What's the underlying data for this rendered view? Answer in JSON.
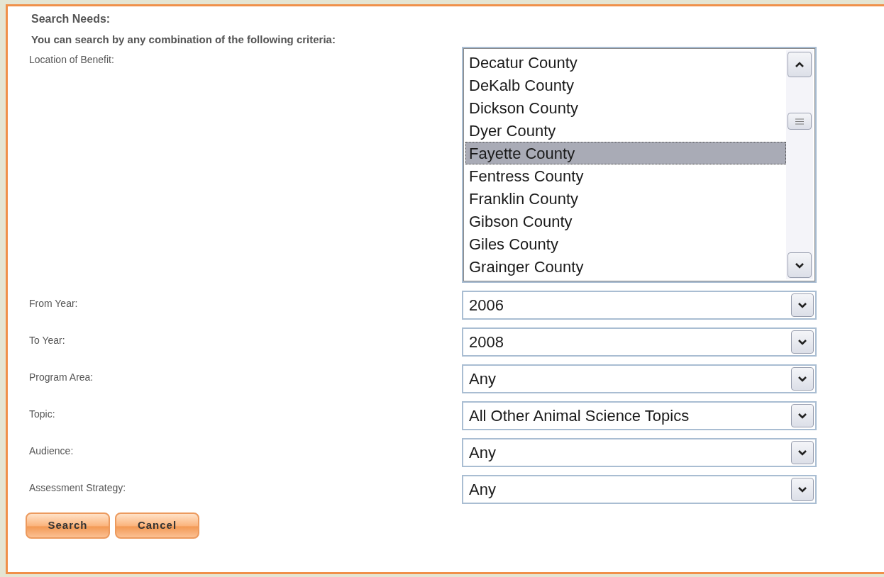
{
  "heading": "Search Needs:",
  "intro": "You can search by any combination of the following criteria:",
  "fields": [
    {
      "kind": "listbox",
      "label": "Location of Benefit:",
      "options": [
        {
          "text": "Decatur County",
          "selected": false
        },
        {
          "text": "DeKalb County",
          "selected": false
        },
        {
          "text": "Dickson County",
          "selected": false
        },
        {
          "text": "Dyer County",
          "selected": false
        },
        {
          "text": "Fayette County",
          "selected": true
        },
        {
          "text": "Fentress County",
          "selected": false
        },
        {
          "text": "Franklin County",
          "selected": false
        },
        {
          "text": "Gibson County",
          "selected": false
        },
        {
          "text": "Giles County",
          "selected": false
        },
        {
          "text": "Grainger County",
          "selected": false
        }
      ]
    },
    {
      "kind": "dropdown",
      "label": "From Year:",
      "value": "2006"
    },
    {
      "kind": "dropdown",
      "label": "To Year:",
      "value": "2008"
    },
    {
      "kind": "dropdown",
      "label": "Program Area:",
      "value": "Any"
    },
    {
      "kind": "dropdown",
      "label": "Topic:",
      "value": "All Other Animal Science Topics"
    },
    {
      "kind": "dropdown",
      "label": "Audience:",
      "value": "Any"
    },
    {
      "kind": "dropdown",
      "label": "Assessment Strategy:",
      "value": "Any"
    }
  ],
  "buttons": [
    "Search",
    "Cancel"
  ]
}
